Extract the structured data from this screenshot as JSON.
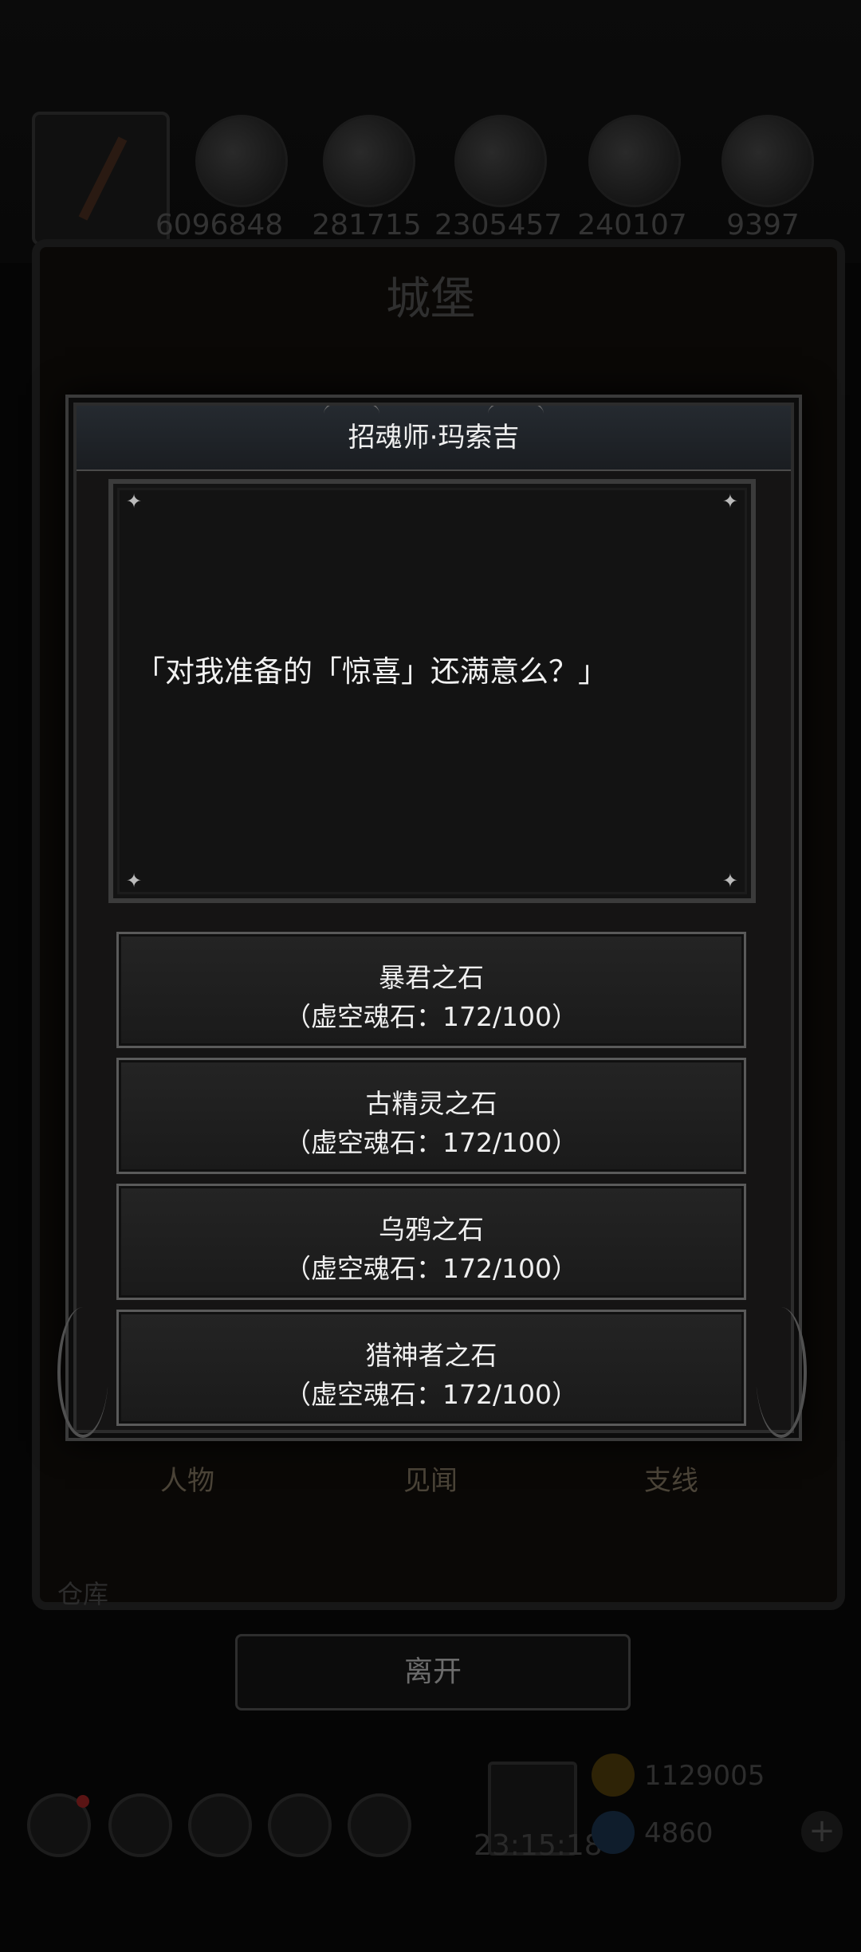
{
  "background": {
    "resources": [
      "6096848",
      "281715",
      "2305457",
      "240107",
      "9397"
    ],
    "castle_title": "城堡",
    "tabs": [
      "人物",
      "见闻",
      "支线"
    ],
    "side_label": "仓库",
    "leave_label": "离开",
    "timer": "23:15:18",
    "gold_amount": "1129005",
    "gem_amount": "4860",
    "plus_label": "+"
  },
  "dialog": {
    "title": "招魂师·玛索吉",
    "speech": "「对我准备的「惊喜」还满意么？」",
    "options": [
      {
        "name": "暴君之石",
        "cost": "（虚空魂石：172/100）"
      },
      {
        "name": "古精灵之石",
        "cost": "（虚空魂石：172/100）"
      },
      {
        "name": "乌鸦之石",
        "cost": "（虚空魂石：172/100）"
      },
      {
        "name": "猎神者之石",
        "cost": "（虚空魂石：172/100）"
      }
    ]
  },
  "colors": {
    "dialog_bg": "#151414",
    "header_bg": "#1f2328",
    "text": "#f0f0f0",
    "gold": "#5a4410",
    "gem": "#1a3550"
  }
}
